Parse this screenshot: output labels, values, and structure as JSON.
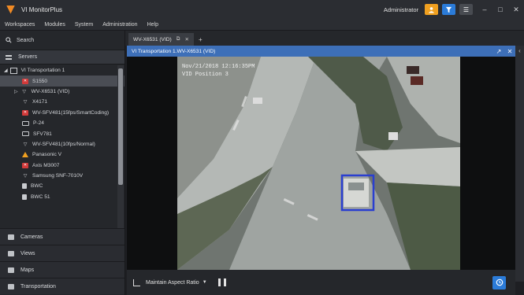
{
  "app": {
    "title": "VI MonitorPlus",
    "user": "Administrator"
  },
  "window": {
    "minimize": "–",
    "maximize": "□",
    "close": "✕"
  },
  "menu": [
    "Workspaces",
    "Modules",
    "System",
    "Administration",
    "Help"
  ],
  "sidebar": {
    "search_label": "Search",
    "servers_label": "Servers",
    "tree": [
      {
        "label": "VI Transportation 1",
        "icon": "server-icon",
        "level": 0
      },
      {
        "label": "S1550",
        "icon": "error-camera-icon",
        "selected": true
      },
      {
        "label": "WV-X6531 (VID)",
        "icon": "camera-icon"
      },
      {
        "label": "X4171",
        "icon": "camera-icon"
      },
      {
        "label": "WV-SFV481(15fps/SmartCoding)",
        "icon": "error-camera-icon"
      },
      {
        "label": "P-24",
        "icon": "camera-icon"
      },
      {
        "label": "SFV781",
        "icon": "camera-icon"
      },
      {
        "label": "WV-SFV481(10fps/Normal)",
        "icon": "camera-icon"
      },
      {
        "label": "Panasonic V",
        "icon": "warning-icon"
      },
      {
        "label": "Axis M3007",
        "icon": "error-camera-icon"
      },
      {
        "label": "Samsung SNF-7010V",
        "icon": "camera-icon"
      },
      {
        "label": "BWC",
        "icon": "bodycam-icon"
      },
      {
        "label": "BWC 51",
        "icon": "bodycam-icon"
      }
    ],
    "sections": [
      "Cameras",
      "Views",
      "Maps",
      "Transportation"
    ]
  },
  "tabs": [
    {
      "label": "WV-X6531 (VID)"
    }
  ],
  "viewer": {
    "title": "VI Transportation 1.WV-X6531 (VID)",
    "overlay_date": "Nov/21/2018 12:16:35PM",
    "overlay_position": "VID Position 3",
    "aspect_label": "Maintain Aspect Ratio"
  },
  "colors": {
    "accent": "#3d6fb8",
    "orange": "#f08a24",
    "detect": "#2a3fd0"
  }
}
